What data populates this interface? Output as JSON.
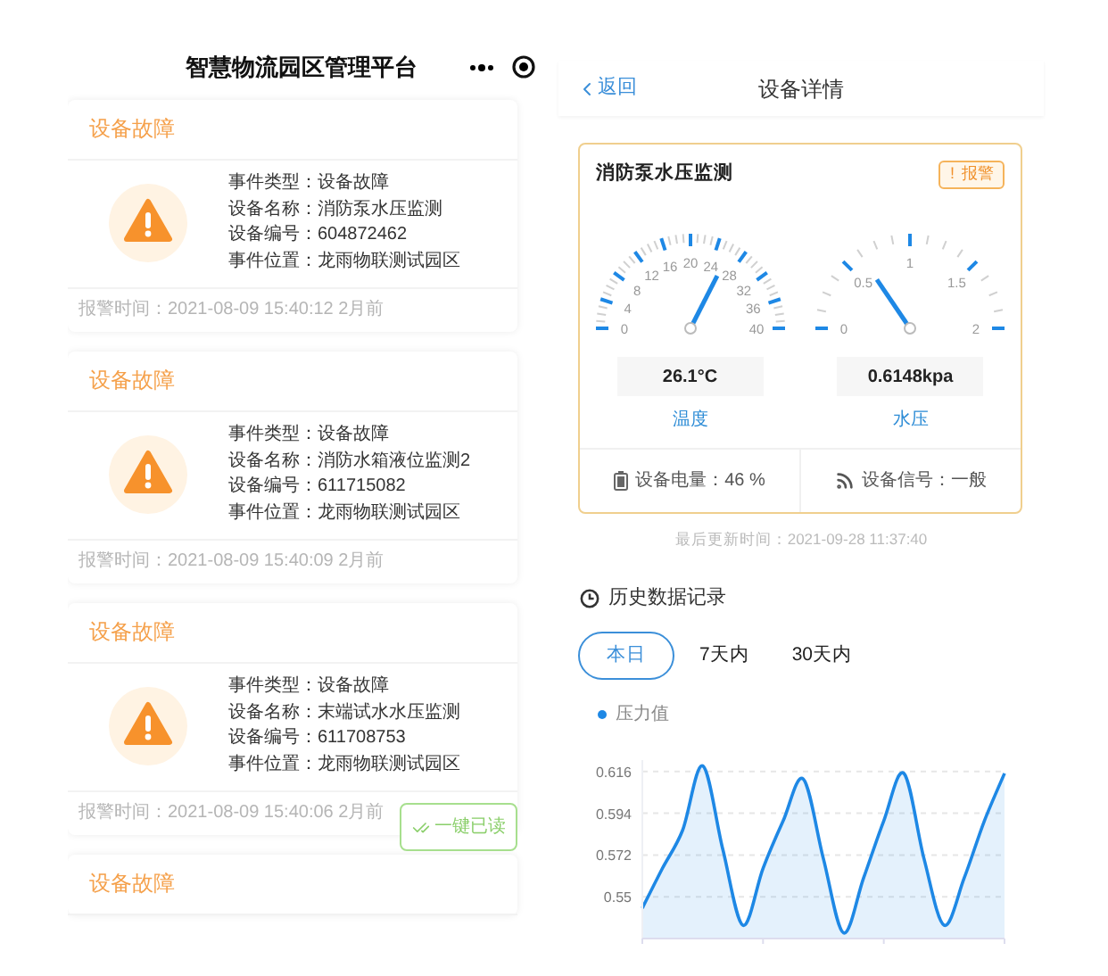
{
  "left": {
    "title": "智慧物流园区管理平台",
    "alarms": [
      {
        "heading": "设备故障",
        "lines": [
          "事件类型：设备故障",
          "设备名称：消防泵水压监测",
          "设备编号：604872462",
          "事件位置：龙雨物联测试园区"
        ],
        "time": "报警时间：2021-08-09 15:40:12 2月前"
      },
      {
        "heading": "设备故障",
        "lines": [
          "事件类型：设备故障",
          "设备名称：消防水箱液位监测2",
          "设备编号：611715082",
          "事件位置：龙雨物联测试园区"
        ],
        "time": "报警时间：2021-08-09 15:40:09 2月前"
      },
      {
        "heading": "设备故障",
        "lines": [
          "事件类型：设备故障",
          "设备名称：末端试水水压监测",
          "设备编号：611708753",
          "事件位置：龙雨物联测试园区"
        ],
        "time": "报警时间：2021-08-09 15:40:06 2月前"
      },
      {
        "heading": "设备故障"
      }
    ],
    "read_all_button": "一键已读"
  },
  "right": {
    "back": "返回",
    "title": "设备详情",
    "device": {
      "name": "消防泵水压监测",
      "badge_icon": "!",
      "badge": "报警",
      "gauges": [
        {
          "ticks": [
            "0",
            "4",
            "8",
            "12",
            "16",
            "20",
            "24",
            "28",
            "32",
            "36",
            "40"
          ],
          "reading": "26.1°C",
          "label": "温度"
        },
        {
          "ticks": [
            "0",
            "0.5",
            "1",
            "1.5",
            "2"
          ],
          "reading": "0.6148kpa",
          "label": "水压"
        }
      ],
      "battery": "设备电量：46 %",
      "signal": "设备信号：一般"
    },
    "updated": "最后更新时间：2021-09-28 11:37:40",
    "history_title": "历史数据记录",
    "tabs": [
      {
        "label": "本日",
        "selected": true
      },
      {
        "label": "7天内",
        "selected": false
      },
      {
        "label": "30天内",
        "selected": false
      }
    ],
    "chart_data": {
      "type": "area",
      "yticks": [
        0.55,
        0.572,
        0.594,
        0.616
      ],
      "ylim": [
        0.528,
        0.622
      ],
      "grid": true,
      "series": [
        {
          "name": "压力值",
          "color": "#1e88e5",
          "values": [
            0.544,
            0.565,
            0.585,
            0.619,
            0.575,
            0.535,
            0.565,
            0.59,
            0.612,
            0.57,
            0.531,
            0.56,
            0.59,
            0.615,
            0.57,
            0.535,
            0.56,
            0.59,
            0.615
          ]
        }
      ]
    }
  }
}
